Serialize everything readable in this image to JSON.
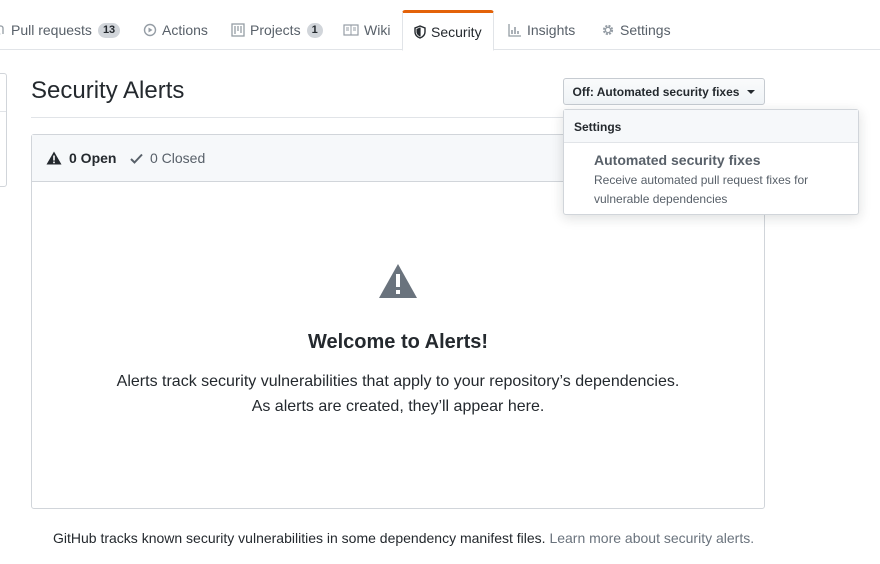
{
  "tabs": [
    {
      "label": "Pull requests",
      "counter": "13",
      "icon": "pull-request-icon"
    },
    {
      "label": "Actions",
      "icon": "play-icon"
    },
    {
      "label": "Projects",
      "counter": "1",
      "icon": "project-icon"
    },
    {
      "label": "Wiki",
      "icon": "book-icon"
    },
    {
      "label": "Security",
      "icon": "shield-icon",
      "selected": true
    },
    {
      "label": "Insights",
      "icon": "graph-icon"
    },
    {
      "label": "Settings",
      "icon": "gear-icon"
    }
  ],
  "header": {
    "title": "Security Alerts",
    "dropdown_label": "Off: Automated security fixes"
  },
  "menu": {
    "header": "Settings",
    "item_title": "Automated security fixes",
    "item_desc_1": "Receive automated pull request fixes for",
    "item_desc_2": "vulnerable dependencies"
  },
  "states": {
    "open": "0 Open",
    "closed": "0 Closed"
  },
  "blankslate": {
    "title": "Welcome to Alerts!",
    "line1": "Alerts track security vulnerabilities that apply to your repository’s dependencies.",
    "line2": "As alerts are created, they’ll appear here."
  },
  "footer": {
    "text": "GitHub tracks known security vulnerabilities in some dependency manifest files.",
    "link": "Learn more about security alerts."
  },
  "colors": {
    "accent_tab": "#e36209",
    "link_muted": "#6a737d"
  }
}
